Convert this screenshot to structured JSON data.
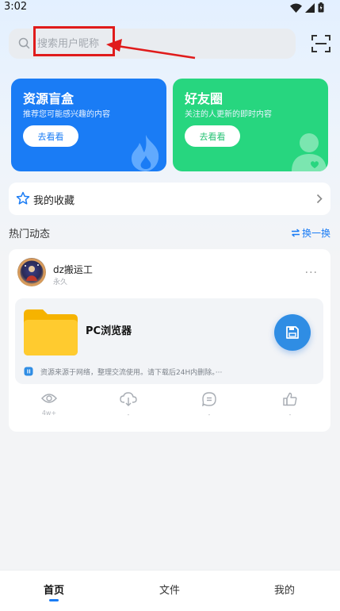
{
  "status_bar": {
    "time": "3:02"
  },
  "search": {
    "placeholder": "搜索用户昵称"
  },
  "cards": [
    {
      "title": "资源盲盒",
      "subtitle": "推荐您可能感兴趣的内容",
      "button": "去看看",
      "color": "#1a7cf5"
    },
    {
      "title": "好友圈",
      "subtitle": "关注的人更新的即时内容",
      "button": "去看看",
      "color": "#27d67f"
    }
  ],
  "favorites": {
    "label": "我的收藏"
  },
  "hot": {
    "title": "热门动态",
    "refresh_label": "换一换"
  },
  "post": {
    "username": "dz搬运工",
    "subtitle": "永久",
    "more": "···",
    "resource_name": "PC浏览器",
    "notice": "资源来源于网络，整理交流使用。请下载后24H内删除。···",
    "actions": [
      {
        "icon": "eye-icon",
        "count": "4w+"
      },
      {
        "icon": "download-cloud-icon",
        "count": "-"
      },
      {
        "icon": "comment-icon",
        "count": "-"
      },
      {
        "icon": "thumbs-up-icon",
        "count": "-"
      }
    ]
  },
  "bottom_nav": {
    "tabs": [
      "首页",
      "文件",
      "我的"
    ],
    "active_index": 0
  },
  "colors": {
    "accent": "#1a7cf5",
    "highlight_box": "#e01b1b"
  }
}
